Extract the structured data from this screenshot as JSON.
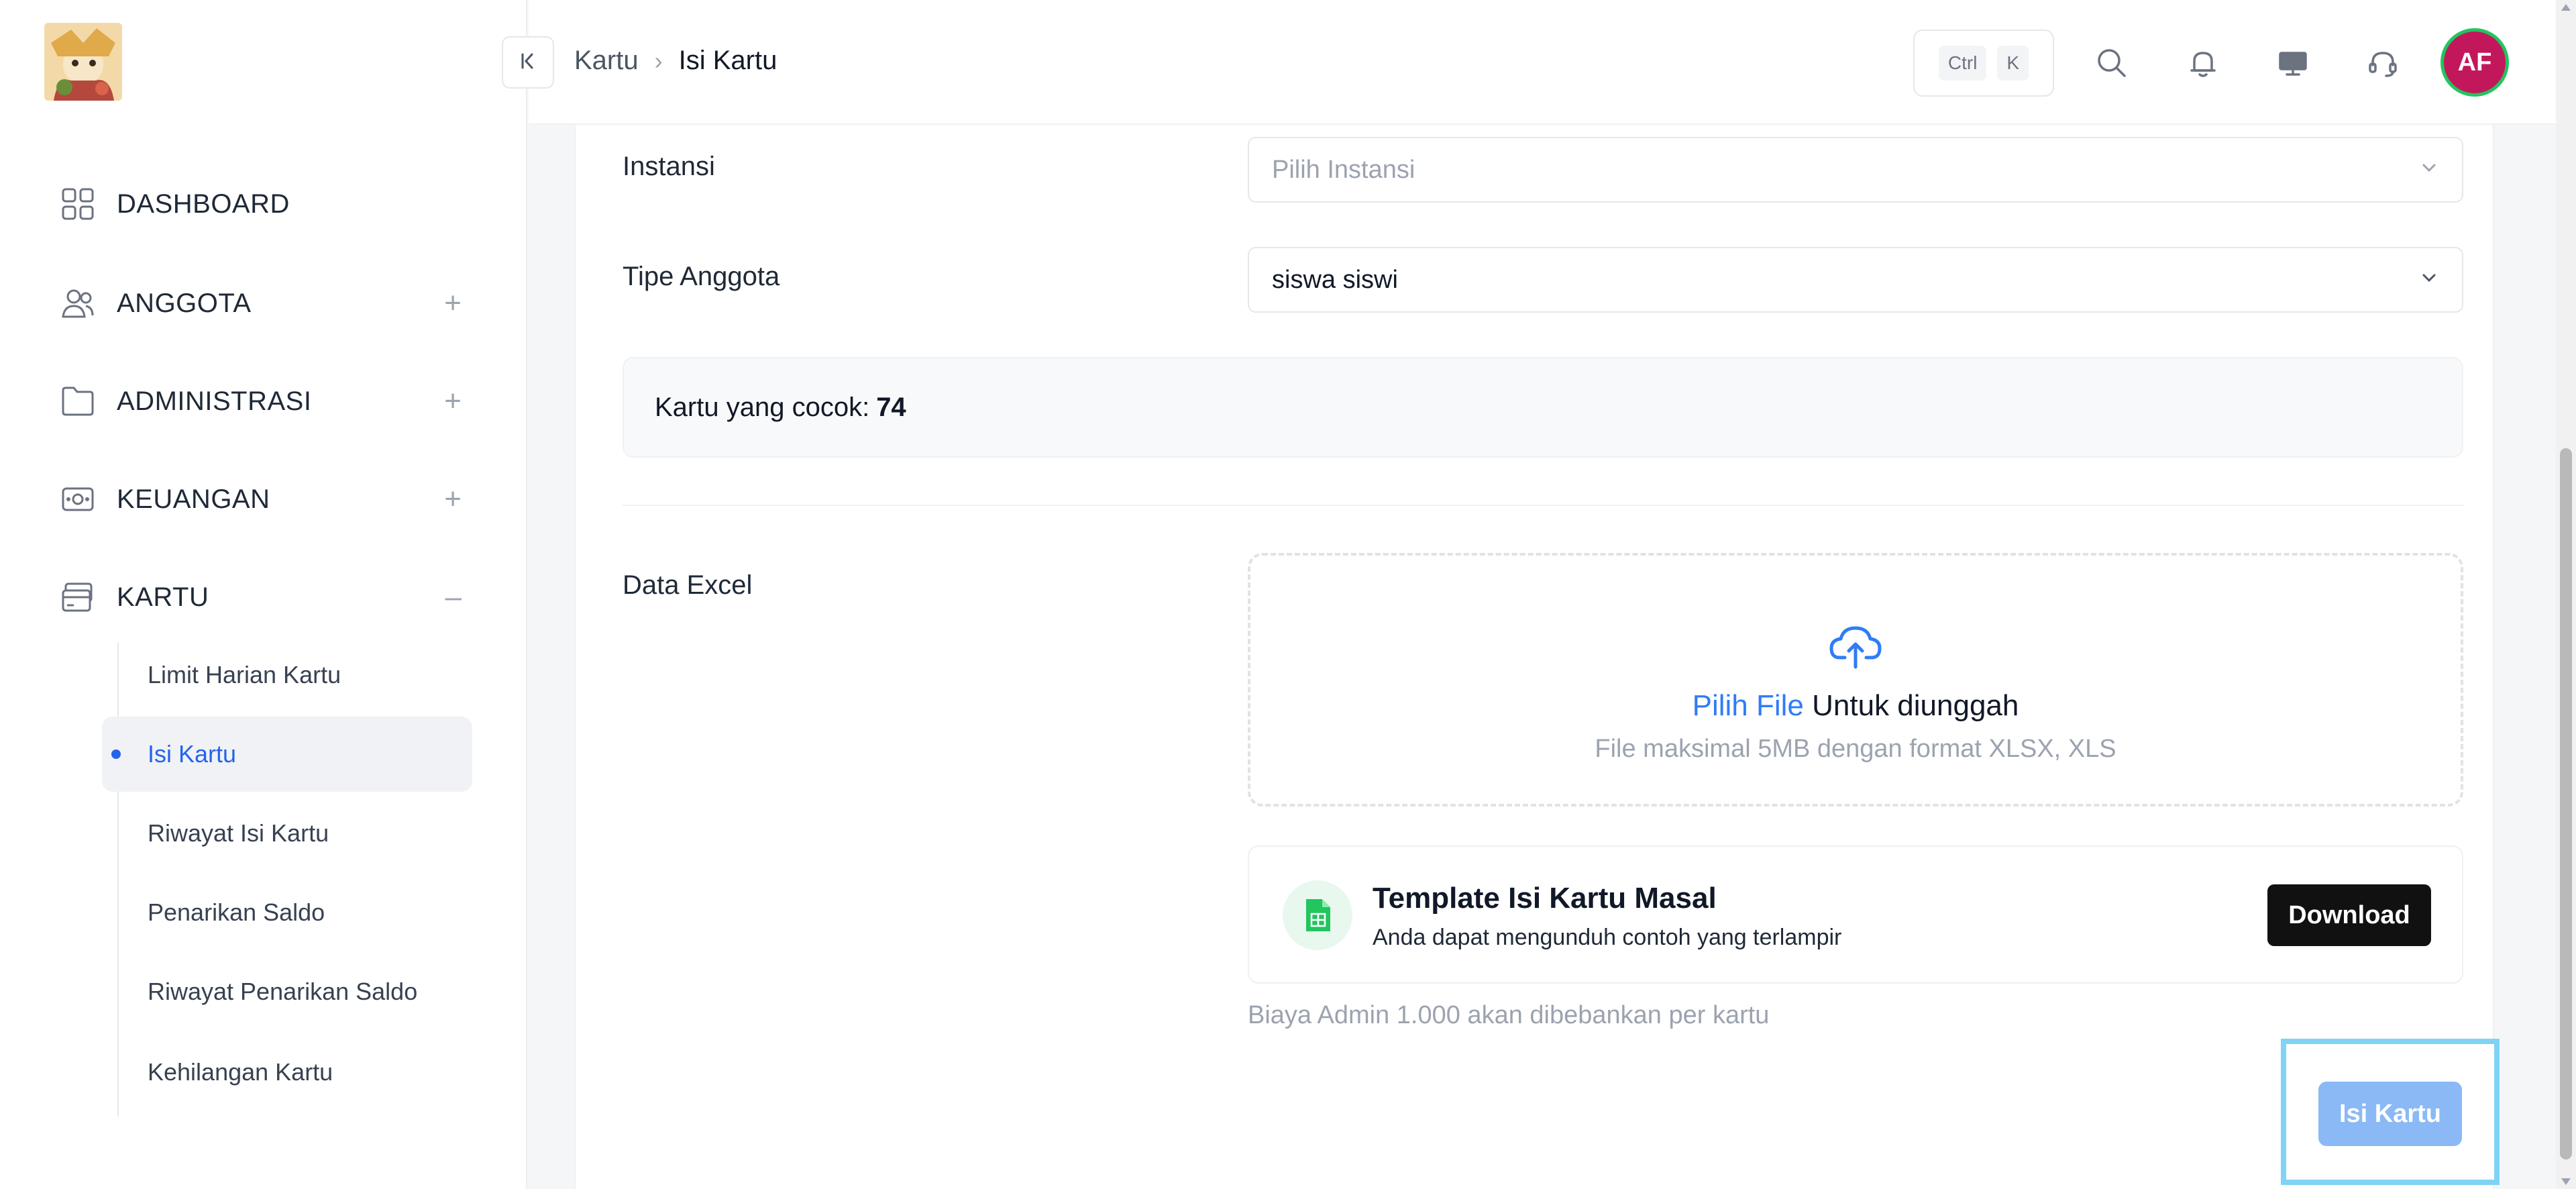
{
  "sidebar": {
    "items": [
      {
        "label": "DASHBOARD",
        "icon": "grid-icon",
        "toggle": ""
      },
      {
        "label": "ANGGOTA",
        "icon": "users-icon",
        "toggle": "+"
      },
      {
        "label": "ADMINISTRASI",
        "icon": "folder-icon",
        "toggle": "+"
      },
      {
        "label": "KEUANGAN",
        "icon": "money-icon",
        "toggle": "+"
      },
      {
        "label": "KARTU",
        "icon": "card-icon",
        "toggle": "–"
      }
    ],
    "sub_items": [
      {
        "label": "Limit Harian Kartu"
      },
      {
        "label": "Isi Kartu",
        "active": true
      },
      {
        "label": "Riwayat Isi Kartu"
      },
      {
        "label": "Penarikan Saldo"
      },
      {
        "label": "Riwayat Penarikan Saldo"
      },
      {
        "label": "Kehilangan Kartu"
      }
    ]
  },
  "header": {
    "breadcrumb": [
      "Kartu",
      "Isi Kartu"
    ],
    "shortcut": [
      "Ctrl",
      "K"
    ],
    "avatar_initials": "AF"
  },
  "form": {
    "instansi_label": "Instansi",
    "instansi_placeholder": "Pilih Instansi",
    "tipe_label": "Tipe Anggota",
    "tipe_value": "siswa siswi",
    "match_label": "Kartu yang cocok:",
    "match_count": "74",
    "excel_label": "Data Excel",
    "upload_link": "Pilih File",
    "upload_text": "Untuk diunggah",
    "upload_hint": "File maksimal 5MB dengan format XLSX, XLS",
    "template_title": "Template Isi Kartu Masal",
    "template_sub": "Anda dapat mengunduh contoh yang terlampir",
    "download_label": "Download",
    "fee_note": "Biaya Admin 1.000 akan dibebankan per kartu",
    "submit_label": "Isi Kartu"
  },
  "colors": {
    "accent": "#2563eb",
    "avatar_bg": "#c2185b",
    "submit_disabled": "#8ab9f6",
    "highlight": "#7fd3f5"
  }
}
